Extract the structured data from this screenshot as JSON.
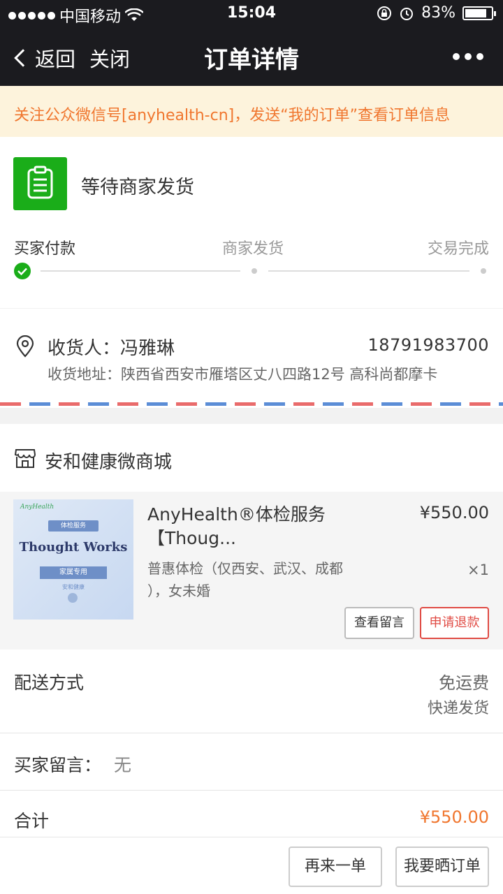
{
  "status_bar": {
    "carrier": "中国移动",
    "time": "15:04",
    "battery": "83%",
    "battery_level": 0.83
  },
  "nav": {
    "back_label": "返回",
    "close_label": "关闭",
    "title": "订单详情"
  },
  "notice": {
    "text": "关注公众微信号[anyhealth-cn]，发送“我的订单”查看订单信息"
  },
  "order_status": {
    "text": "等待商家发货",
    "steps": [
      "买家付款",
      "商家发货",
      "交易完成"
    ],
    "current_step": 1
  },
  "address": {
    "receiver_label": "收货人：冯雅琳",
    "phone": "18791983700",
    "address_text": "收货地址：陕西省西安市雁塔区丈八四路12号 高科尚都摩卡"
  },
  "shop": {
    "name": "安和健康微商城"
  },
  "product": {
    "title_line1": "AnyHealth®体检服务",
    "title_line2": "【Thoug...",
    "price": "¥550.00",
    "spec_line1": "普惠体检（仅西安、武汉、成都",
    "spec_line2": "），女未婚",
    "quantity": "×1",
    "thumb": {
      "brand": "AnyHealth",
      "tag1": "体检服务",
      "main": "Thought Works",
      "tag2": "家属专用",
      "small": "安和健康"
    },
    "view_message_label": "查看留言",
    "refund_label": "申请退款"
  },
  "delivery": {
    "label": "配送方式",
    "fee": "免运费",
    "method": "快递发货"
  },
  "buyer_message": {
    "label": "买家留言：",
    "value": "无"
  },
  "total": {
    "label": "合计",
    "value": "¥550.00"
  },
  "actions": {
    "reorder_label": "再来一单",
    "share_label": "我要晒订单"
  },
  "colors": {
    "accent_green": "#1aad19",
    "accent_orange": "#f0762e",
    "refund_red": "#e04b44",
    "nav_bg": "#1b1b1f"
  }
}
